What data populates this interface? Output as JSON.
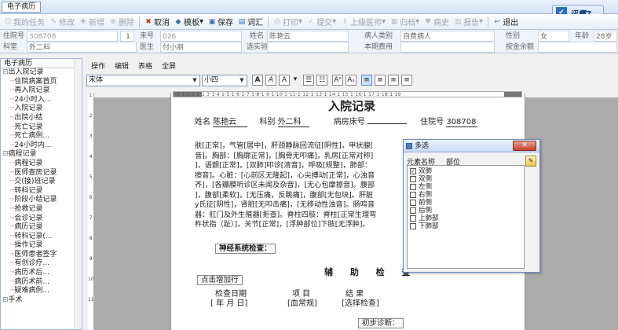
{
  "titlebar": {
    "app_tab": "电子病历"
  },
  "logo": {
    "text": "迅霸7"
  },
  "toolbar": {
    "items": [
      {
        "label": "我的任务",
        "icon": "task-icon",
        "enabled": false
      },
      {
        "label": "修改",
        "icon": "edit-icon",
        "enabled": false
      },
      {
        "label": "新增",
        "icon": "add-icon",
        "enabled": false
      },
      {
        "label": "删除",
        "icon": "delete-icon",
        "enabled": false
      },
      {
        "label": "取消",
        "icon": "cancel-icon",
        "enabled": true
      },
      {
        "label": "模板",
        "icon": "template-icon",
        "enabled": true
      },
      {
        "label": "保存",
        "icon": "save-icon",
        "enabled": true
      },
      {
        "label": "词汇",
        "icon": "vocabulary-icon",
        "enabled": true
      },
      {
        "label": "打印",
        "icon": "print-icon",
        "enabled": false
      },
      {
        "label": "提交",
        "icon": "submit-icon",
        "enabled": false
      },
      {
        "label": "上级医师",
        "icon": "doctor-icon",
        "enabled": false
      },
      {
        "label": "归档",
        "icon": "archive-icon",
        "enabled": false
      },
      {
        "label": "病史",
        "icon": "history-icon",
        "enabled": false
      },
      {
        "label": "报告",
        "icon": "report-icon",
        "enabled": false
      },
      {
        "label": "退出",
        "icon": "exit-icon",
        "enabled": true
      }
    ]
  },
  "patient": {
    "row1": [
      {
        "label": "住院号",
        "value": "308708"
      },
      {
        "label": "床号",
        "value": "1"
      },
      {
        "label": "来号",
        "value": "026"
      },
      {
        "label": "姓名",
        "value": "陈艳云"
      },
      {
        "label": "病人类别",
        "value": "自费病人"
      },
      {
        "label": "性别",
        "value": "女"
      },
      {
        "label": "年龄",
        "value": "28岁"
      }
    ],
    "row2": [
      {
        "label": "科室",
        "value": "外二科"
      },
      {
        "label": "医生",
        "value": "付小丽"
      },
      {
        "label": "选实验",
        "value": ""
      },
      {
        "label": "本期费用",
        "value": ""
      },
      {
        "label": "按金余额",
        "value": ""
      }
    ]
  },
  "sidebar": {
    "header": "电子病历",
    "tree": [
      {
        "label": "出入院记录",
        "level": 0
      },
      {
        "label": "住院病案首页",
        "level": 1
      },
      {
        "label": "再入院记录",
        "level": 1
      },
      {
        "label": "24小时入...",
        "level": 1
      },
      {
        "label": "入院记录",
        "level": 1
      },
      {
        "label": "出院小结",
        "level": 1
      },
      {
        "label": "死亡记录",
        "level": 1
      },
      {
        "label": "死亡病例...",
        "level": 1
      },
      {
        "label": "24小时内...",
        "level": 1
      },
      {
        "label": "病程记录",
        "level": 0
      },
      {
        "label": "病程记录",
        "level": 1
      },
      {
        "label": "医师查房记录",
        "level": 1
      },
      {
        "label": "交(接)班记录",
        "level": 1
      },
      {
        "label": "转科记录",
        "level": 1
      },
      {
        "label": "阶段小结记录",
        "level": 1
      },
      {
        "label": "抢救记录",
        "level": 1
      },
      {
        "label": "会诊记录",
        "level": 1
      },
      {
        "label": "病历记录",
        "level": 1
      },
      {
        "label": "转科记录(...",
        "level": 1
      },
      {
        "label": "操作记录",
        "level": 1
      },
      {
        "label": "医师患者签字",
        "level": 1
      },
      {
        "label": "有创诊疗...",
        "level": 1
      },
      {
        "label": "病历术后...",
        "level": 1
      },
      {
        "label": "病历术前...",
        "level": 1
      },
      {
        "label": "疑难病例...",
        "level": 1
      },
      {
        "label": "手术",
        "level": 0
      }
    ]
  },
  "editor_menu": [
    "操作",
    "编辑",
    "表格",
    "全屏"
  ],
  "format": {
    "font": "宋体",
    "size": "小四"
  },
  "ruler": {
    "text": "·2·1·1·1·2·1·3·1·4·1·5·1·6·1·7·1·8·1·9·1·10·1·11·1·12·1·13·1·14·1·15·1·16·1·17·1·18·1·19"
  },
  "document": {
    "title": "入院记录",
    "name_label": "姓名",
    "name": "陈艳云",
    "dept_label": "科别",
    "dept": "外二科",
    "bed_label": "病房床号",
    "inpatient_label": "住院号",
    "inpatient_no": "308708",
    "lines": [
      "肤[正常]，气管[居中]，肝颈静脉回流征[阴性]，甲状腺[",
      "音]。胸部：[胸廓正常]，[胸骨无叩痛]，乳房[正常对称]",
      "]，语颤[正常]，[双肺]叩诊[清音]，呼吸[规整]，肺部：",
      "擦音]。心脏：[心前区无隆起]，心尖搏动[正常]，心浊音",
      "齐]，[各瓣膜听诊区未闻及杂音]，[无心包摩擦音]。腹部",
      "]，腹部[柔软]，[无压痛，反跳痛]，腹部[无包块]。肝脏",
      "y氏征[阴性]，肾脏[无叩击痛]，[无移动性浊音]。肠鸣音",
      "器：肛门及外生殖器[拒查]。脊柱四肢：脊柱[正常生理弯",
      "杵状指（趾）]，关节[正常]，[浮肿部位]下肢[无浮肿]。"
    ],
    "neuro_btn": "神经系统检查：",
    "aux_title": "辅 助 检 查",
    "add_btn": "点击增加行",
    "col_date": "检查日期",
    "col_item": "项 目",
    "col_result": "结 果",
    "date_val": "[ 年 月 日]",
    "item_val": "[血常规]",
    "result_val": "[选择检查]",
    "diag_btn": "初步诊断："
  },
  "dialog": {
    "title": "多选",
    "col1": "元素名称",
    "col2": "部位",
    "options": [
      {
        "label": "双肺",
        "checked": true
      },
      {
        "label": "双侧",
        "checked": false
      },
      {
        "label": "左侧",
        "checked": false
      },
      {
        "label": "右侧",
        "checked": false
      },
      {
        "label": "前侧",
        "checked": false
      },
      {
        "label": "后侧",
        "checked": false
      },
      {
        "label": "上肺部",
        "checked": false
      },
      {
        "label": "下肺部",
        "checked": false
      }
    ]
  }
}
